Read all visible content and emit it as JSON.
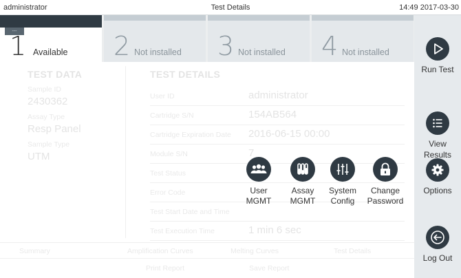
{
  "topbar": {
    "user": "administrator",
    "title": "Test Details",
    "clock": "14:49 2017-03-30"
  },
  "modules": [
    {
      "number": "1",
      "label": "Available",
      "tag": "---"
    },
    {
      "number": "2",
      "label": "Not installed"
    },
    {
      "number": "3",
      "label": "Not installed"
    },
    {
      "number": "4",
      "label": "Not installed"
    }
  ],
  "sidebar": {
    "run_test": {
      "label": "Run Test",
      "icon": "play-icon"
    },
    "view_results": {
      "label_line1": "View",
      "label_line2": "Results",
      "icon": "list-icon"
    },
    "options": {
      "label": "Options",
      "icon": "gear-icon"
    },
    "log_out": {
      "label": "Log Out",
      "icon": "logout-icon"
    }
  },
  "test_data": {
    "title": "TEST DATA",
    "fields": [
      {
        "label": "Sample ID",
        "value": "2430362"
      },
      {
        "label": "Assay Type",
        "value": "Resp Panel"
      },
      {
        "label": "Sample Type",
        "value": "UTM"
      }
    ]
  },
  "test_details": {
    "title": "TEST DETAILS",
    "rows": [
      {
        "label": "User ID",
        "value": "administrator"
      },
      {
        "label": "Cartridge S/N",
        "value": "154AB564"
      },
      {
        "label": "Cartridge Expiration Date",
        "value": "2016-06-15 00:00"
      },
      {
        "label": "Module S/N",
        "value": "7"
      },
      {
        "label": "Test Status",
        "value": ""
      },
      {
        "label": "Error Code",
        "value": ""
      },
      {
        "label": "Test Start Date and Time",
        "value": ""
      },
      {
        "label": "Test Execution Time",
        "value": "1 min 6 sec"
      }
    ]
  },
  "bottom_tabs": [
    "Summary",
    "Amplification Curves",
    "Melting Curves",
    "Test Details"
  ],
  "actions": {
    "print": "Print Report",
    "save": "Save Report"
  },
  "options_menu": [
    {
      "line1": "User",
      "line2": "MGMT",
      "icon": "users-icon"
    },
    {
      "line1": "Assay",
      "line2": "MGMT",
      "icon": "test-tubes-icon"
    },
    {
      "line1": "System",
      "line2": "Config",
      "icon": "sliders-icon"
    },
    {
      "line1": "Change",
      "line2": "Password",
      "icon": "lock-icon"
    }
  ]
}
